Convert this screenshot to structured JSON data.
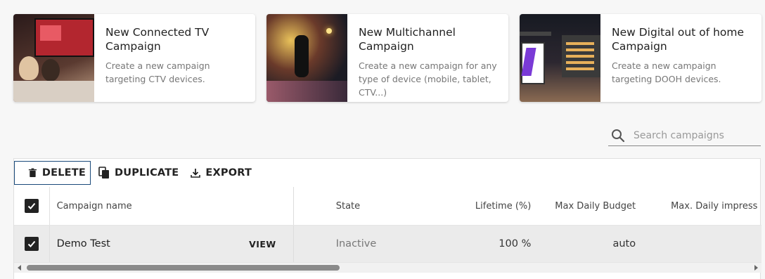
{
  "cards": [
    {
      "title": "New Connected TV Campaign",
      "description": "Create a new campaign targeting CTV devices."
    },
    {
      "title": "New Multichannel Campaign",
      "description": "Create a new campaign for any type of device (mobile, tablet, CTV...)"
    },
    {
      "title": "New Digital out of home Campaign",
      "description": "Create a new campaign targeting DOOH devices."
    }
  ],
  "search": {
    "placeholder": "Search campaigns",
    "value": ""
  },
  "toolbar": {
    "delete_label": "DELETE",
    "duplicate_label": "DUPLICATE",
    "export_label": "EXPORT"
  },
  "table": {
    "columns": [
      "Campaign name",
      "State",
      "Lifetime (%)",
      "Max Daily Budget",
      "Max. Daily impress"
    ],
    "rows": [
      {
        "checked": true,
        "name": "Demo Test",
        "view_label": "VIEW",
        "state": "Inactive",
        "lifetime": "100 %",
        "budget": "auto",
        "impressions": ""
      }
    ]
  },
  "colors": {
    "accent_border": "#1a4a7a",
    "checkbox": "#222222"
  }
}
